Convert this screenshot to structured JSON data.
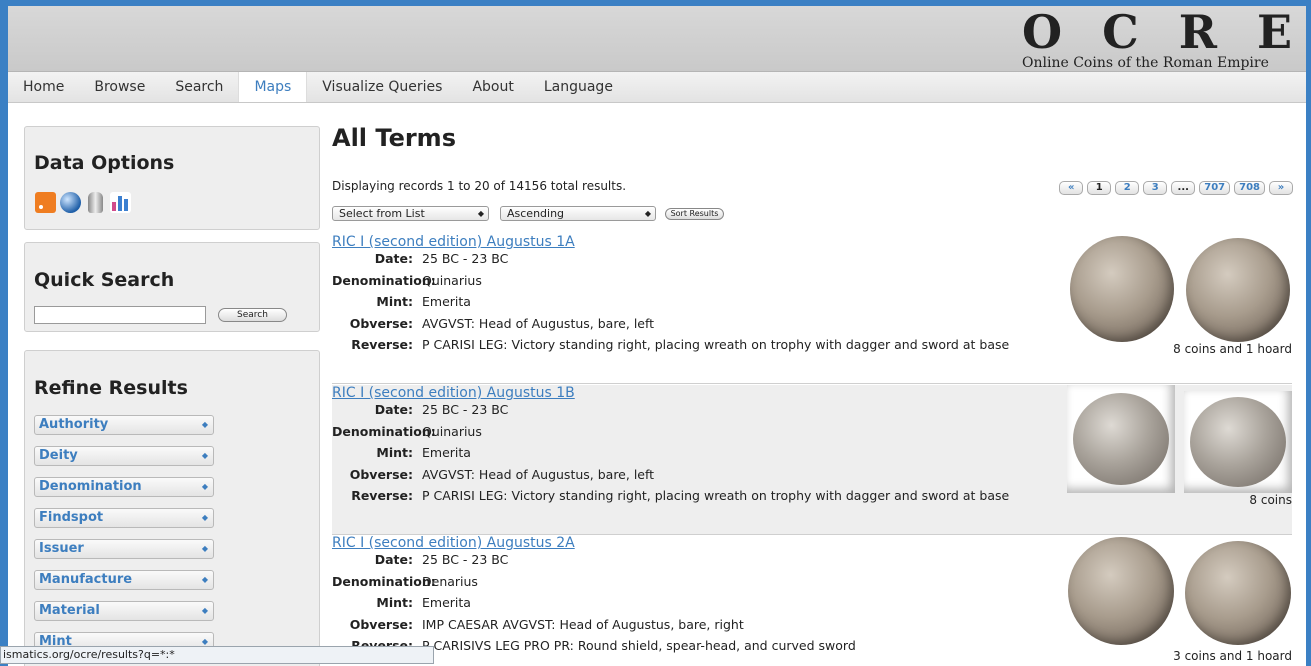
{
  "logo": {
    "letters": [
      "O",
      "C",
      "R",
      "E"
    ],
    "subtitle": "Online Coins of the Roman Empire"
  },
  "nav": [
    {
      "label": "Home"
    },
    {
      "label": "Browse"
    },
    {
      "label": "Search"
    },
    {
      "label": "Maps",
      "active": true
    },
    {
      "label": "Visualize Queries"
    },
    {
      "label": "About"
    },
    {
      "label": "Language"
    }
  ],
  "sidebar": {
    "data_options": {
      "title": "Data Options",
      "icons": [
        "rss-feed-icon",
        "kml-globe-icon",
        "database-icon",
        "chart-icon"
      ]
    },
    "quick_search": {
      "title": "Quick Search",
      "input_value": "",
      "button_label": "Search"
    },
    "refine": {
      "title": "Refine Results",
      "facets": [
        "Authority",
        "Deity",
        "Denomination",
        "Findspot",
        "Issuer",
        "Manufacture",
        "Material",
        "Mint"
      ]
    }
  },
  "main": {
    "title": "All Terms",
    "record_count": "Displaying records 1 to 20 of 14156 total results.",
    "pager": [
      "«",
      "1",
      "2",
      "3",
      "...",
      "707",
      "708",
      "»"
    ],
    "sort_field": "Select from List",
    "sort_order": "Ascending",
    "sort_button": "Sort Results",
    "results": [
      {
        "title": "RIC I (second edition) Augustus 1A",
        "fields": [
          {
            "label": "Date:",
            "value": "25 BC - 23 BC"
          },
          {
            "label": "Denomination:",
            "value": "Quinarius"
          },
          {
            "label": "Mint:",
            "value": "Emerita"
          },
          {
            "label": "Obverse:",
            "value": "AVGVST: Head of Augustus, bare, left"
          },
          {
            "label": "Reverse:",
            "value": "P CARISI LEG: Victory standing right, placing wreath on trophy with dagger and sword at base"
          }
        ],
        "caption": "8 coins and 1 hoard"
      },
      {
        "title": "RIC I (second edition) Augustus 1B",
        "fields": [
          {
            "label": "Date:",
            "value": "25 BC - 23 BC"
          },
          {
            "label": "Denomination:",
            "value": "Quinarius"
          },
          {
            "label": "Mint:",
            "value": "Emerita"
          },
          {
            "label": "Obverse:",
            "value": "AVGVST: Head of Augustus, bare, left"
          },
          {
            "label": "Reverse:",
            "value": "P CARISI LEG: Victory standing right, placing wreath on trophy with dagger and sword at base"
          }
        ],
        "caption": "8 coins"
      },
      {
        "title": "RIC I (second edition) Augustus 2A",
        "fields": [
          {
            "label": "Date:",
            "value": "25 BC - 23 BC"
          },
          {
            "label": "Denomination:",
            "value": "Denarius"
          },
          {
            "label": "Mint:",
            "value": "Emerita"
          },
          {
            "label": "Obverse:",
            "value": "IMP CAESAR AVGVST: Head of Augustus, bare, right"
          },
          {
            "label": "Reverse:",
            "value": "P CARISIVS LEG PRO PR: Round shield, spear-head, and curved sword"
          }
        ],
        "caption": "3 coins and 1 hoard"
      }
    ]
  },
  "status_bar": "ismatics.org/ocre/results?q=*:*",
  "colors": {
    "frame": "#3b80c4",
    "link": "#3d7ebf",
    "rss": "#ef7d21"
  }
}
